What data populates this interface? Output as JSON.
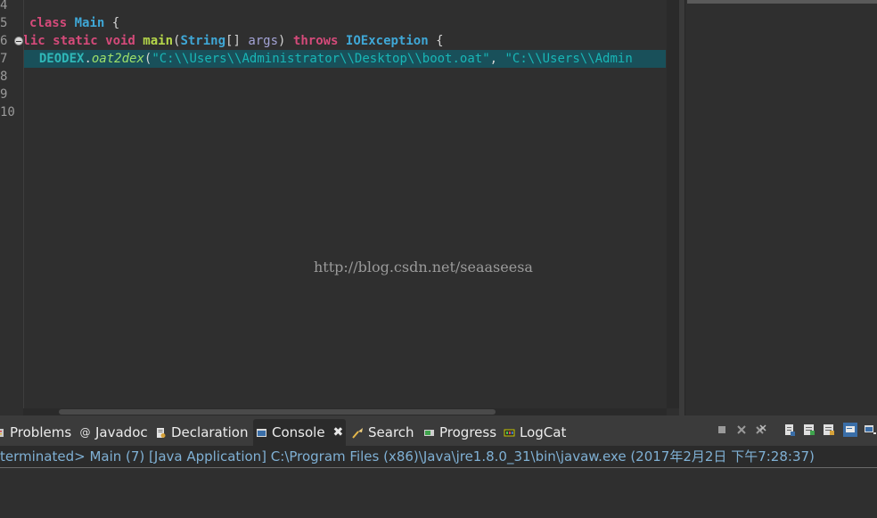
{
  "editor": {
    "line_numbers": [
      "4",
      "5",
      "6",
      "7",
      "8",
      "9",
      "10"
    ],
    "line5": {
      "kw": "class",
      "name": "Main",
      "rest": " {"
    },
    "line6": {
      "kw1": "blic static void",
      "fn": "main",
      "p1": "(",
      "type1": "String",
      "p2": "[] ",
      "param": "args",
      "p3": ") ",
      "kw2": "throws",
      "sp": " ",
      "type2": "IOException",
      "p4": " {"
    },
    "line7": {
      "cls": "DEODEX",
      "dot": ".",
      "method": "oat2dex",
      "open": "(",
      "str1": "\"C:\\\\Users\\\\Administrator\\\\Desktop\\\\boot.oat\"",
      "comma": ", ",
      "str2": "\"C:\\\\Users\\\\Admin"
    },
    "watermark": "http://blog.csdn.net/seaaseesa"
  },
  "tabs": [
    {
      "label": "Problems",
      "icon": "problems-icon"
    },
    {
      "label": "Javadoc",
      "icon": "javadoc-icon"
    },
    {
      "label": "Declaration",
      "icon": "declaration-icon"
    },
    {
      "label": "Console",
      "icon": "console-icon",
      "active": true
    },
    {
      "label": "Search",
      "icon": "search-icon"
    },
    {
      "label": "Progress",
      "icon": "progress-icon"
    },
    {
      "label": "LogCat",
      "icon": "logcat-icon"
    }
  ],
  "console": {
    "status_line": "terminated> Main (7) [Java Application] C:\\Program Files (x86)\\Java\\jre1.8.0_31\\bin\\javaw.exe (2017年2月2日 下午7:28:37)"
  },
  "colors": {
    "keyword": "#d54a7a",
    "type": "#3fa7d6",
    "string": "#18b6b6",
    "highlight": "#19505a"
  }
}
